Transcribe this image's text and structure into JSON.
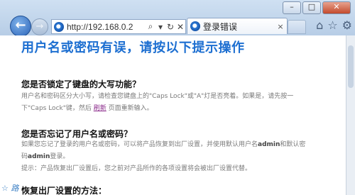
{
  "browser": {
    "address_url": "http://192.168.0.2",
    "address_tools": [
      "⌕",
      "▾",
      "↻",
      "✕"
    ],
    "tab_title": "登录错误",
    "tab_close": "×",
    "window_controls": [
      "–",
      "□",
      "✕"
    ],
    "toolbar_icons": [
      "home-icon",
      "star-icon",
      "gear-icon"
    ]
  },
  "page": {
    "title": "用户名或密码有误，请按以下提示操作",
    "sections": [
      {
        "heading": "您是否锁定了键盘的大写功能？",
        "line1": "用户名和密码区分大小写，请检查您键盘上的\"Caps Lock\"或\"A\"灯是否亮着。如果是，请先按一",
        "line2_before": "下\"Caps Lock\"键，然后",
        "line2_link": "刷新",
        "line2_after": "页面重新输入。"
      },
      {
        "heading": "您是否忘记了用户名或密码？",
        "line1_before": "如果您忘记了登录的用户名或密码，可以将产品恢复到出厂设置，并使用默认用户名",
        "line1_bold": "admin",
        "line1_after": "和默认密",
        "line2_before": "码",
        "line2_bold": "admin",
        "line2_after": "登录。",
        "tip": "提示：产品恢复出厂设置后，您之前对产品所作的各项设置将会被出厂设置代替。"
      },
      {
        "heading": "恢复出厂设置的方法："
      }
    ]
  },
  "watermark": "☆ 路"
}
